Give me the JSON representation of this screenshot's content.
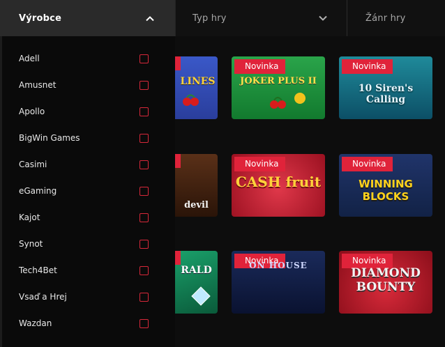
{
  "filters": {
    "manufacturer": {
      "label": "Výrobce"
    },
    "game_type": {
      "label": "Typ hry"
    },
    "genre": {
      "label": "Žánr hry"
    }
  },
  "manufacturers": [
    {
      "label": "Adell",
      "checked": false
    },
    {
      "label": "Amusnet",
      "checked": false
    },
    {
      "label": "Apollo",
      "checked": false
    },
    {
      "label": "BigWin Games",
      "checked": false
    },
    {
      "label": "Casimi",
      "checked": false
    },
    {
      "label": "eGaming",
      "checked": false
    },
    {
      "label": "Kajot",
      "checked": false
    },
    {
      "label": "Synot",
      "checked": false
    },
    {
      "label": "Tech4Bet",
      "checked": false
    },
    {
      "label": "Vsaď a Hrej",
      "checked": false
    },
    {
      "label": "Wazdan",
      "checked": false
    }
  ],
  "games": {
    "badge_label": "Novinka",
    "items": [
      {
        "title": "LINES",
        "badge": false
      },
      {
        "title": "JOKER PLUS II",
        "badge": true
      },
      {
        "title": "10 Siren's Calling",
        "badge": true
      },
      {
        "title": "devil",
        "badge": false
      },
      {
        "title": "CASH fruit",
        "badge": true
      },
      {
        "title": "WINNING BLOCKS",
        "badge": true
      },
      {
        "title": "RALD",
        "badge": false
      },
      {
        "title": "ON HOUSE",
        "badge": true
      },
      {
        "title": "DIAMOND BOUNTY",
        "badge": true
      }
    ]
  },
  "colors": {
    "accent": "#e0233a",
    "panel": "#0a0a0a",
    "active_filter": "#2a2a2a"
  }
}
